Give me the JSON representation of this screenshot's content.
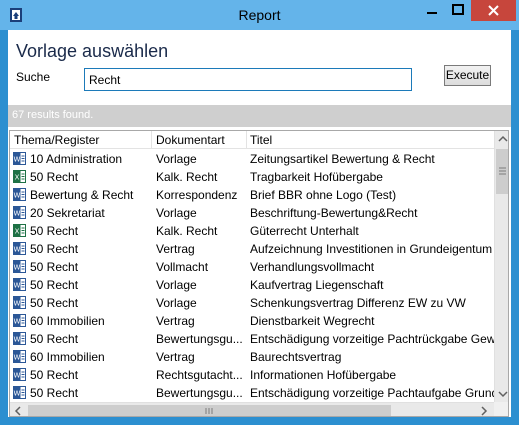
{
  "window": {
    "title": "Report",
    "controls": {
      "minimize_icon": "minimize-icon",
      "maximize_icon": "maximize-icon",
      "close_icon": "close-icon"
    }
  },
  "dialog": {
    "heading": "Vorlage auswählen",
    "search": {
      "label": "Suche",
      "value": "Recht",
      "placeholder": ""
    },
    "execute_label": "Execute",
    "status": "67 results found."
  },
  "table": {
    "columns": [
      "Thema/Register",
      "Dokumentart",
      "Titel"
    ],
    "rows": [
      {
        "icon": "word-document-icon",
        "thema": "10 Administration",
        "art": "Vorlage",
        "titel": "Zeitungsartikel Bewertung & Recht"
      },
      {
        "icon": "excel-document-icon",
        "thema": "50 Recht",
        "art": "Kalk. Recht",
        "titel": "Tragbarkeit Hofübergabe"
      },
      {
        "icon": "word-document-icon",
        "thema": "Bewertung & Recht",
        "art": "Korrespondenz",
        "titel": "Brief BBR ohne Logo (Test)"
      },
      {
        "icon": "word-document-icon",
        "thema": "20 Sekretariat",
        "art": "Vorlage",
        "titel": "Beschriftung-Bewertung&Recht"
      },
      {
        "icon": "excel-document-icon",
        "thema": "50 Recht",
        "art": "Kalk. Recht",
        "titel": "Güterrecht Unterhalt"
      },
      {
        "icon": "word-document-icon",
        "thema": "50 Recht",
        "art": "Vertrag",
        "titel": "Aufzeichnung Investitionen in Grundeigentum Ehe"
      },
      {
        "icon": "word-document-icon",
        "thema": "50 Recht",
        "art": "Vollmacht",
        "titel": "Verhandlungsvollmacht"
      },
      {
        "icon": "word-document-icon",
        "thema": "50 Recht",
        "art": "Vorlage",
        "titel": "Kaufvertrag Liegenschaft"
      },
      {
        "icon": "word-document-icon",
        "thema": "50 Recht",
        "art": "Vorlage",
        "titel": "Schenkungsvertrag Differenz EW zu VW"
      },
      {
        "icon": "word-document-icon",
        "thema": "60 Immobilien",
        "art": "Vertrag",
        "titel": "Dienstbarkeit Wegrecht"
      },
      {
        "icon": "word-document-icon",
        "thema": "50 Recht",
        "art": "Bewertungsgu...",
        "titel": "Entschädigung vorzeitige Pachtrückgabe Gewerbe"
      },
      {
        "icon": "word-document-icon",
        "thema": "60 Immobilien",
        "art": "Vertrag",
        "titel": "Baurechtsvertrag"
      },
      {
        "icon": "word-document-icon",
        "thema": "50 Recht",
        "art": "Rechtsgutacht...",
        "titel": "Informationen Hofübergabe"
      },
      {
        "icon": "word-document-icon",
        "thema": "50 Recht",
        "art": "Bewertungsgu...",
        "titel": "Entschädigung vorzeitige Pachtaufgabe Grundstück"
      }
    ]
  },
  "scrollbars": {
    "vertical": {
      "up_icon": "scroll-up-arrow-icon",
      "down_icon": "scroll-down-arrow-icon",
      "grip_icon": "scroll-grip-icon"
    },
    "horizontal": {
      "left_icon": "scroll-left-arrow-icon",
      "right_icon": "scroll-right-arrow-icon",
      "grip_icon": "scroll-grip-icon"
    }
  },
  "colors": {
    "window_frame": "#2c8fd0",
    "titlebar": "#64b4ea",
    "close_button": "#c7463c",
    "search_border": "#1c7ab9",
    "status_bar": "#cfcfcf",
    "word_icon": "#2b5797",
    "excel_icon": "#1e7145"
  }
}
